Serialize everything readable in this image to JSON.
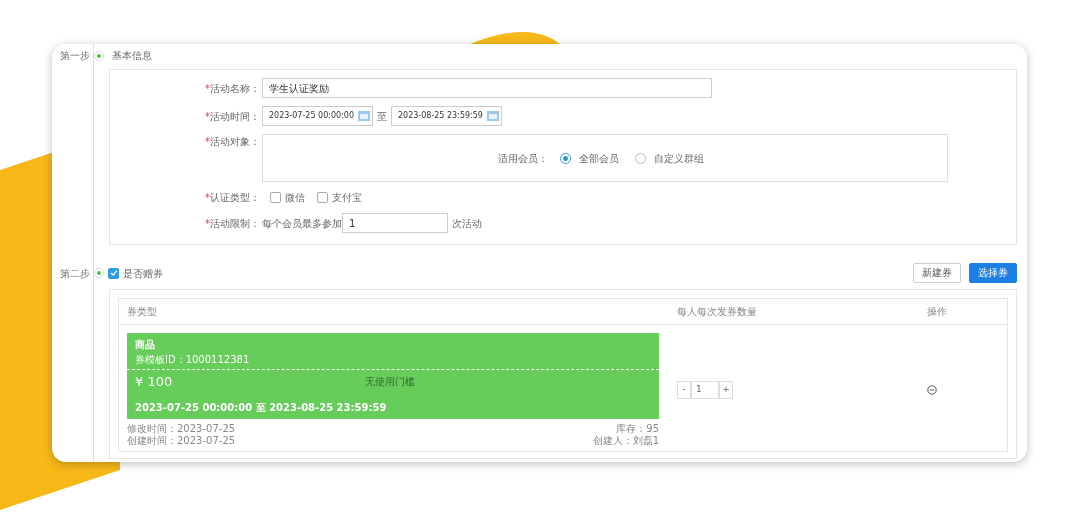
{
  "step1": {
    "label": "第一步",
    "title": "基本信息",
    "fields": [
      {
        "kind": "text",
        "mark": "*",
        "label": "活动名称：",
        "value": "学生认证奖励"
      },
      {
        "kind": "daterange",
        "mark": "*",
        "label": "活动时间：",
        "start": "2023-07-25 00:00:00",
        "separator": "至",
        "end": "2023-08-25 23:59:59"
      },
      {
        "kind": "radio",
        "mark": "*",
        "label": "活动对象：",
        "sublabel": "适用会员：",
        "options": [
          {
            "label": "全部会员",
            "selected": true
          },
          {
            "label": "自定义群组",
            "selected": false
          }
        ]
      },
      {
        "kind": "checkbox",
        "mark": "*",
        "label": "认证类型：",
        "options": [
          {
            "label": "微信",
            "checked": false
          },
          {
            "label": "支付宝",
            "checked": false
          }
        ]
      },
      {
        "kind": "limit",
        "mark": "*",
        "label": "活动限制：",
        "prefix": "每个会员最多参加",
        "value": "1",
        "suffix": "次活动"
      }
    ]
  },
  "step2": {
    "label": "第二步",
    "toggle": {
      "label": "是否赠券",
      "checked": true
    },
    "buttons": [
      {
        "label": "新建券",
        "kind": "default"
      },
      {
        "label": "选择券",
        "kind": "primary"
      }
    ],
    "table": {
      "columns": [
        "券类型",
        "每人每次发券数量",
        "操作"
      ],
      "rows": [
        {
          "coupon": {
            "type": "商品",
            "template_id": "券模板ID：1000112381",
            "amount": "¥ 100",
            "condition": "无使用门槛",
            "validity": "2023-07-25 00:00:00 至 2023-08-25 23:59:59",
            "modified": "修改时间：2023-07-25",
            "created": "创建时间：2023-07-25",
            "stock": "库存：95",
            "creator": "创建人：刘磊1"
          },
          "minus": "-",
          "quantity": "1",
          "plus": "+"
        }
      ]
    }
  }
}
